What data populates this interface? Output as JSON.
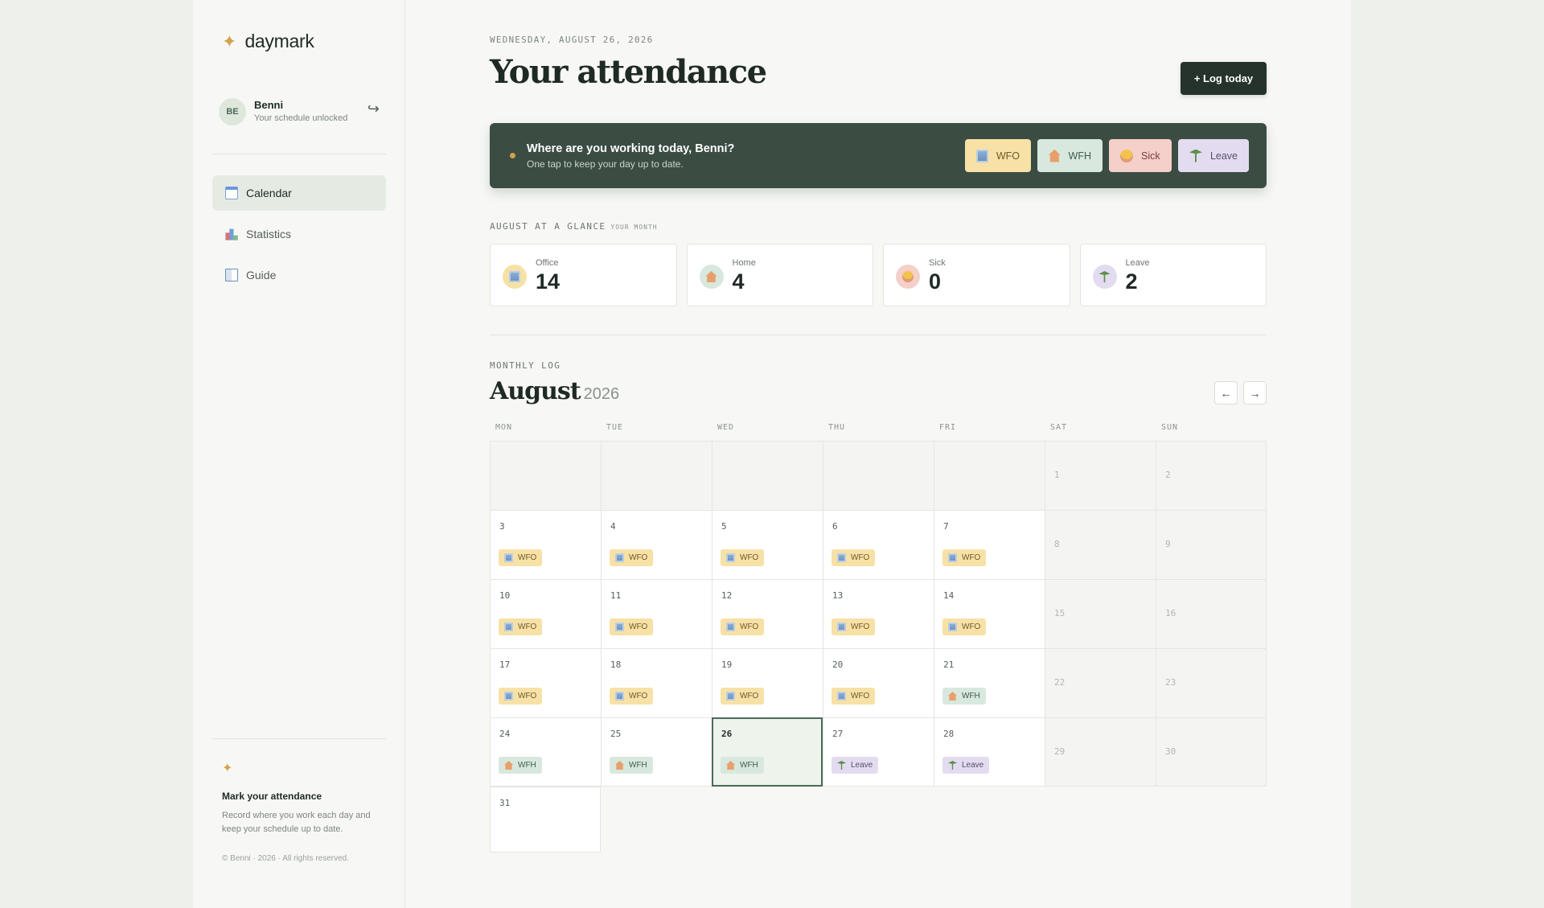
{
  "app": {
    "brand": "daymark"
  },
  "user": {
    "initials": "BE",
    "name": "Benni",
    "subtitle": "Your schedule unlocked"
  },
  "nav": [
    {
      "label": "Calendar",
      "icon": "calendar-icon",
      "active": true
    },
    {
      "label": "Statistics",
      "icon": "bar-chart-icon",
      "active": false
    },
    {
      "label": "Guide",
      "icon": "book-icon",
      "active": false
    }
  ],
  "tip": {
    "title": "Mark your attendance",
    "text": "Record where you work each day and keep your schedule up to date.",
    "copyright": "© Benni · 2026 · All rights reserved."
  },
  "header": {
    "date": "WEDNESDAY, AUGUST 26, 2026",
    "title": "Your attendance",
    "log_button": "+ Log today"
  },
  "banner": {
    "title": "Where are you working today, Benni?",
    "subtitle": "One tap to keep your day up to date.",
    "options": [
      {
        "label": "WFO",
        "icon": "office-building-icon"
      },
      {
        "label": "WFH",
        "icon": "house-icon"
      },
      {
        "label": "Sick",
        "icon": "sick-face-icon"
      },
      {
        "label": "Leave",
        "icon": "palm-tree-icon"
      }
    ]
  },
  "glance": {
    "eyebrow": "AUGUST AT A GLANCE",
    "eyebrow_small": "YOUR MONTH",
    "stats": [
      {
        "label": "Office",
        "value": "14",
        "icon": "office-building-icon"
      },
      {
        "label": "Home",
        "value": "4",
        "icon": "house-icon"
      },
      {
        "label": "Sick",
        "value": "0",
        "icon": "sick-face-icon"
      },
      {
        "label": "Leave",
        "value": "2",
        "icon": "palm-tree-icon"
      }
    ]
  },
  "calendar": {
    "eyebrow": "MONTHLY LOG",
    "month": "August",
    "year": "2026",
    "prev_label": "←",
    "next_label": "→",
    "weekdays": [
      "MON",
      "TUE",
      "WED",
      "THU",
      "FRI",
      "SAT",
      "SUN"
    ],
    "today": 26,
    "days": [
      {
        "d": 1,
        "status": null
      },
      {
        "d": 2,
        "status": null
      },
      {
        "d": 3,
        "status": "WFO"
      },
      {
        "d": 4,
        "status": "WFO"
      },
      {
        "d": 5,
        "status": "WFO"
      },
      {
        "d": 6,
        "status": "WFO"
      },
      {
        "d": 7,
        "status": "WFO"
      },
      {
        "d": 8,
        "status": null
      },
      {
        "d": 9,
        "status": null
      },
      {
        "d": 10,
        "status": "WFO"
      },
      {
        "d": 11,
        "status": "WFO"
      },
      {
        "d": 12,
        "status": "WFO"
      },
      {
        "d": 13,
        "status": "WFO"
      },
      {
        "d": 14,
        "status": "WFO"
      },
      {
        "d": 15,
        "status": null
      },
      {
        "d": 16,
        "status": null
      },
      {
        "d": 17,
        "status": "WFO"
      },
      {
        "d": 18,
        "status": "WFO"
      },
      {
        "d": 19,
        "status": "WFO"
      },
      {
        "d": 20,
        "status": "WFO"
      },
      {
        "d": 21,
        "status": "WFH"
      },
      {
        "d": 22,
        "status": null
      },
      {
        "d": 23,
        "status": null
      },
      {
        "d": 24,
        "status": "WFH"
      },
      {
        "d": 25,
        "status": "WFH"
      },
      {
        "d": 26,
        "status": "WFH"
      },
      {
        "d": 27,
        "status": "Leave"
      },
      {
        "d": 28,
        "status": "Leave"
      },
      {
        "d": 29,
        "status": null
      },
      {
        "d": 30,
        "status": null
      },
      {
        "d": 31,
        "status": null
      }
    ]
  },
  "colors": {
    "accent": "#d4a24c",
    "dark": "#26332c",
    "banner": "#3b4d43",
    "wfo": "#f7e1a6",
    "wfh": "#d8e8de",
    "sick": "#f5cfc9",
    "leave": "#e3dbef"
  }
}
